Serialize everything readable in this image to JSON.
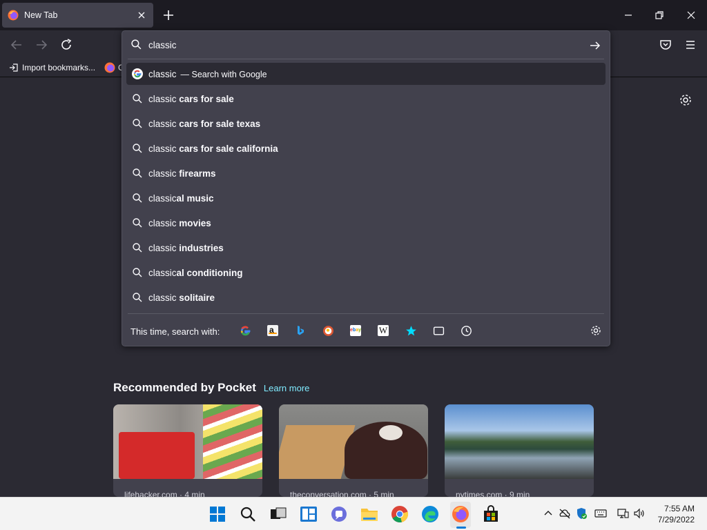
{
  "tab": {
    "title": "New Tab"
  },
  "bookmarks": [
    {
      "label": "Import bookmarks..."
    },
    {
      "label": "G"
    }
  ],
  "urlbar": {
    "input_value": "classic",
    "suggestions": [
      {
        "prefix": "classic",
        "rest": "",
        "sub": "— Search with Google",
        "icon": "google-icon"
      },
      {
        "prefix": "classic ",
        "rest": "cars for sale",
        "icon": "search-icon"
      },
      {
        "prefix": "classic ",
        "rest": "cars for sale texas",
        "icon": "search-icon"
      },
      {
        "prefix": "classic ",
        "rest": "cars for sale california",
        "icon": "search-icon"
      },
      {
        "prefix": "classic ",
        "rest": "firearms",
        "icon": "search-icon"
      },
      {
        "prefix": "classic",
        "rest": "al music",
        "icon": "search-icon"
      },
      {
        "prefix": "classic ",
        "rest": "movies",
        "icon": "search-icon"
      },
      {
        "prefix": "classic ",
        "rest": "industries",
        "icon": "search-icon"
      },
      {
        "prefix": "classic",
        "rest": "al conditioning",
        "icon": "search-icon"
      },
      {
        "prefix": "classic ",
        "rest": "solitaire",
        "icon": "search-icon"
      }
    ],
    "footer_label": "This time, search with:",
    "engines": [
      "google-icon",
      "amazon-icon",
      "bing-icon",
      "duckduckgo-icon",
      "ebay-icon",
      "wikipedia-icon",
      "bookmarks-star-icon",
      "tabs-icon",
      "history-icon"
    ]
  },
  "pocket": {
    "title": "Recommended by Pocket",
    "learn_more": "Learn more",
    "cards": [
      {
        "source": "lifehacker.com · 4 min"
      },
      {
        "source": "theconversation.com · 5 min"
      },
      {
        "source": "nytimes.com · 9 min"
      }
    ]
  },
  "clock": {
    "time": "7:55 AM",
    "date": "7/29/2022"
  },
  "colors": {
    "accent": "#80ebff",
    "panel": "#42414d",
    "background": "#2b2a33"
  }
}
